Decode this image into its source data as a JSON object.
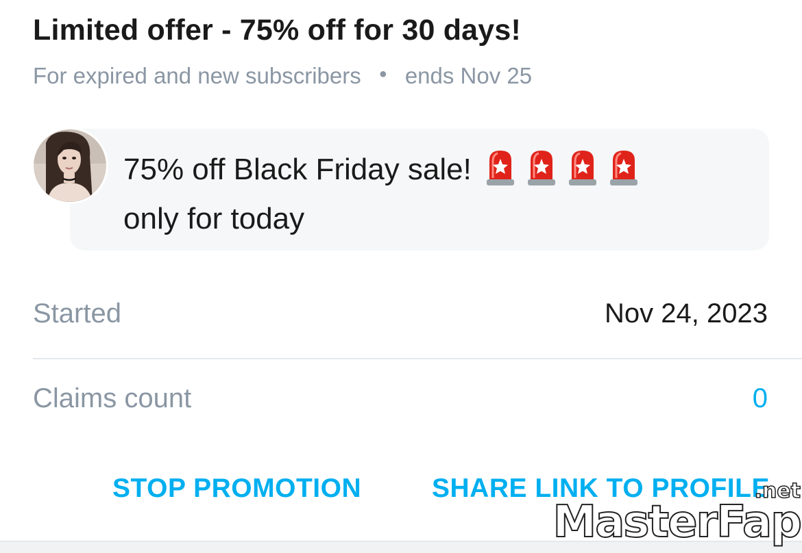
{
  "promotion": {
    "title": "Limited offer - 75% off for 30 days!",
    "audience": "For expired and new subscribers",
    "ends": "ends Nov 25"
  },
  "message": {
    "line1": "75% off Black Friday sale!",
    "line2": "only for today",
    "emoji_icon": "police-car-light-icon",
    "emoji_count": 4
  },
  "details": {
    "started_label": "Started",
    "started_value": "Nov 24, 2023",
    "claims_label": "Claims count",
    "claims_value": "0"
  },
  "actions": {
    "stop_label": "STOP PROMOTION",
    "share_label": "SHARE LINK TO PROFILE"
  },
  "watermark": {
    "brand": "MasterFap",
    "tld": ".net"
  },
  "colors": {
    "accent": "#00aff0",
    "muted": "#8a96a3",
    "text": "#1a1a1a",
    "bubble": "#f5f7f8"
  }
}
